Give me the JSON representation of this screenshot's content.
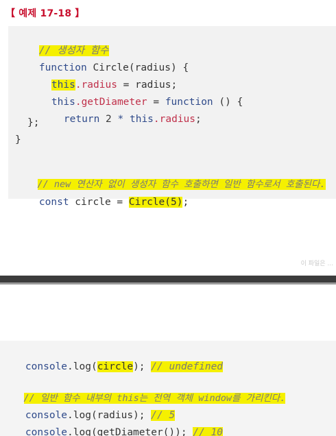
{
  "title": "【 예제 17-18 】",
  "top_code": {
    "line1_comment": "// 생성자 함수",
    "line2_function": "function",
    "line2_name": " Circle(radius) {",
    "line3_this": "this",
    "line3_prop": ".radius",
    "line3_rest": " = radius;",
    "line4_this": "this",
    "line4_prop": ".getDiameter",
    "line4_eq": " = ",
    "line4_function": "function",
    "line4_rest": " () {",
    "line5_return": "return",
    "line5_num": " 2 ",
    "line5_op": "* ",
    "line5_this": "this",
    "line5_prop": ".radius",
    "line5_end": ";",
    "line6": "};",
    "line7": "}",
    "line8_comment": "// new 연산자 없이 생성자 함수 호출하면 일반 함수로서 호출된다.",
    "line9_const": "const",
    "line9_mid": " circle = ",
    "line9_call": "Circle(5)",
    "line9_end": ";"
  },
  "faint_text": "이 파일은 ...",
  "bottom_code": {
    "line1_obj": "console",
    "line1_fn": ".log(",
    "line1_arg": "circle",
    "line1_end": "); ",
    "line1_comment": "// undefined",
    "line2_comment": "// 일반 함수 내부의 this는 전역 객체 window를 가리킨다.",
    "line3_obj": "console",
    "line3_fn": ".log(radius); ",
    "line3_comment": "// 5",
    "line4_obj": "console",
    "line4_fn": ".log(getDiameter()); ",
    "line4_comment": "// 10"
  }
}
